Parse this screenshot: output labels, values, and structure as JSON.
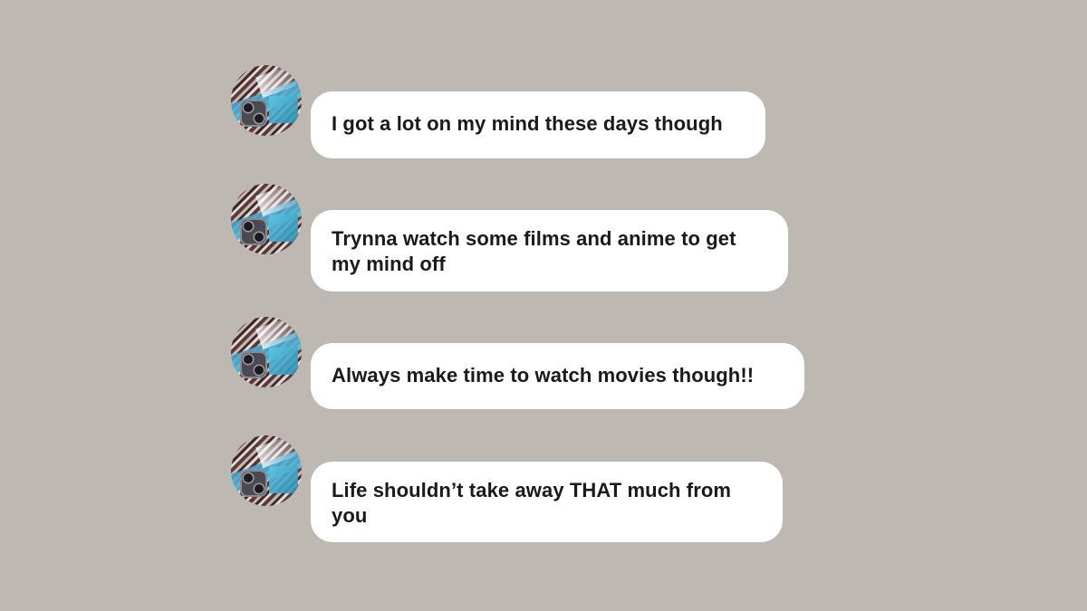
{
  "colors": {
    "background": "#bdb8b1",
    "bubble": "#ffffff",
    "text": "#1a1a1a"
  },
  "messages": [
    {
      "avatar_icon": "profile-photo-icon",
      "text": "I got a lot on my mind these days though"
    },
    {
      "avatar_icon": "profile-photo-icon",
      "text": "Trynna watch some films and anime to get my mind off"
    },
    {
      "avatar_icon": "profile-photo-icon",
      "text": "Always make time to watch movies though!!"
    },
    {
      "avatar_icon": "profile-photo-icon",
      "text": "Life shouldn’t take away THAT much from you"
    }
  ]
}
